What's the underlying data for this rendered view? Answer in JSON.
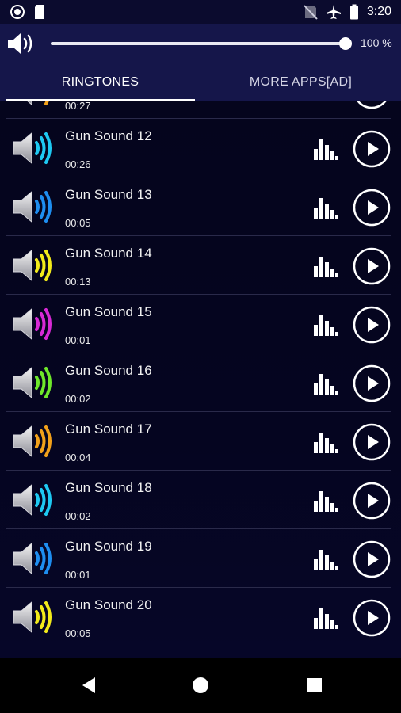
{
  "status_bar": {
    "time": "3:20"
  },
  "volume": {
    "percent_label": "100 %",
    "level": 1.0
  },
  "tabs": [
    {
      "label": "RINGTONES",
      "active": true
    },
    {
      "label": "MORE APPS[AD]",
      "active": false
    }
  ],
  "sounds": [
    {
      "name": "",
      "duration": "00:27",
      "color": "#f2a11a"
    },
    {
      "name": "Gun Sound 12",
      "duration": "00:26",
      "color": "#1ec9f2"
    },
    {
      "name": "Gun Sound 13",
      "duration": "00:05",
      "color": "#1e8ef0"
    },
    {
      "name": "Gun Sound 14",
      "duration": "00:13",
      "color": "#f2ea1a"
    },
    {
      "name": "Gun Sound 15",
      "duration": "00:01",
      "color": "#d829d6"
    },
    {
      "name": "Gun Sound 16",
      "duration": "00:02",
      "color": "#6ee82a"
    },
    {
      "name": "Gun Sound 17",
      "duration": "00:04",
      "color": "#f2a11a"
    },
    {
      "name": "Gun Sound 18",
      "duration": "00:02",
      "color": "#1ec9f2"
    },
    {
      "name": "Gun Sound 19",
      "duration": "00:01",
      "color": "#1e8ef0"
    },
    {
      "name": "Gun Sound 20",
      "duration": "00:05",
      "color": "#f2ea1a"
    }
  ],
  "icons": {
    "row_speaker": "speaker-icon",
    "row_equalizer": "equalizer-icon",
    "row_play": "play-circle-icon",
    "nav_back": "back-triangle-icon",
    "nav_home": "home-circle-icon",
    "nav_recents": "recents-square-icon"
  },
  "colors": {
    "header_bg": "#15164a",
    "list_bg": "#05051d",
    "status_bg": "#0b0b2e"
  }
}
